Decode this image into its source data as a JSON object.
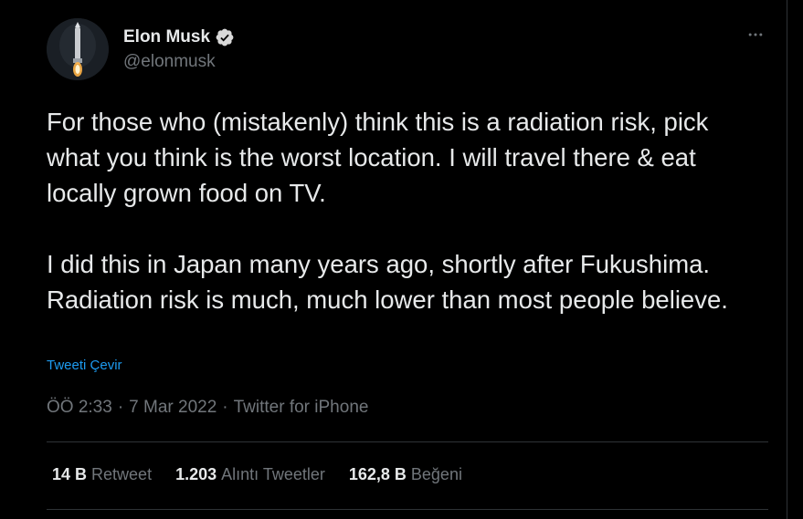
{
  "author": {
    "display_name": "Elon Musk",
    "handle": "@elonmusk",
    "verified": true,
    "avatar_icon": "rocket-avatar-icon"
  },
  "menu": {
    "more_icon": "more-horizontal-icon"
  },
  "tweet": {
    "paragraphs": [
      "For those who (mistakenly) think this is a radiation risk, pick what you think is the worst location. I will travel there & eat locally grown food on TV.",
      "I did this in Japan many years ago, shortly after Fukushima. Radiation risk is much, much lower than most people believe."
    ],
    "translate_label": "Tweeti Çevir"
  },
  "meta": {
    "time": "ÖÖ 2:33",
    "separator": "·",
    "date": "7 Mar 2022",
    "source": "Twitter for iPhone"
  },
  "stats": {
    "retweets": {
      "count": "14 B",
      "label": "Retweet"
    },
    "quotes": {
      "count": "1.203",
      "label": "Alıntı Tweetler"
    },
    "likes": {
      "count": "162,8 B",
      "label": "Beğeni"
    }
  },
  "colors": {
    "background": "#000000",
    "text_primary": "#e7e9ea",
    "text_secondary": "#71767b",
    "link": "#1d9bf0",
    "divider": "#2f3336",
    "verified_badge": "#d9d9d9"
  }
}
